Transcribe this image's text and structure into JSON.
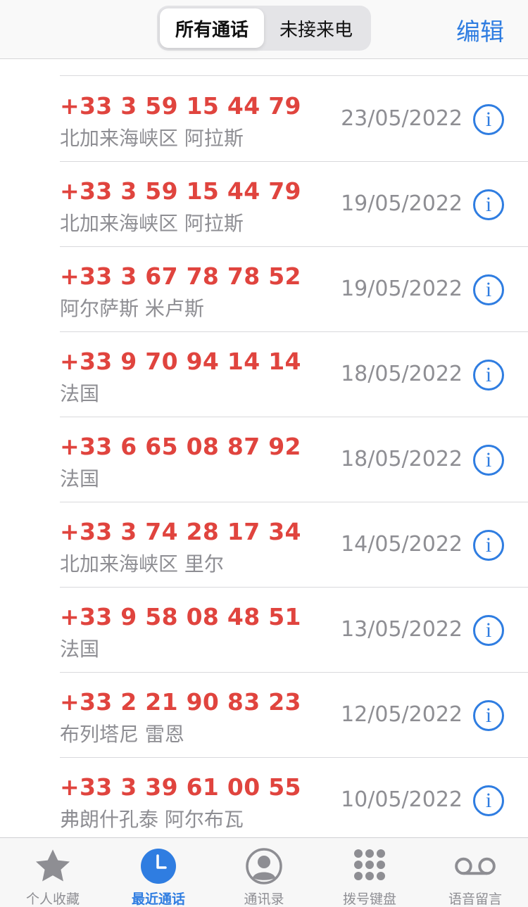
{
  "header": {
    "segments": [
      "所有通话",
      "未接来电"
    ],
    "edit_label": "编辑"
  },
  "calls": [
    {
      "number": "+33 3 59 15 44 79",
      "location": "北加来海峡区 阿拉斯",
      "date": "23/05/2022"
    },
    {
      "number": "+33 3 59 15 44 79",
      "location": "北加来海峡区 阿拉斯",
      "date": "19/05/2022"
    },
    {
      "number": "+33 3 67 78 78 52",
      "location": "阿尔萨斯 米卢斯",
      "date": "19/05/2022"
    },
    {
      "number": "+33 9 70 94 14 14",
      "location": "法国",
      "date": "18/05/2022"
    },
    {
      "number": "+33 6 65 08 87 92",
      "location": "法国",
      "date": "18/05/2022"
    },
    {
      "number": "+33 3 74 28 17 34",
      "location": "北加来海峡区 里尔",
      "date": "14/05/2022"
    },
    {
      "number": "+33 9 58 08 48 51",
      "location": "法国",
      "date": "13/05/2022"
    },
    {
      "number": "+33 2 21 90 83 23",
      "location": "布列塔尼 雷恩",
      "date": "12/05/2022"
    },
    {
      "number": "+33 3 39 61 00 55",
      "location": "弗朗什孔泰 阿尔布瓦",
      "date": "10/05/2022"
    }
  ],
  "tabbar": {
    "tabs": [
      {
        "label": "个人收藏",
        "icon": "star-icon"
      },
      {
        "label": "最近通话",
        "icon": "clock-icon"
      },
      {
        "label": "通讯录",
        "icon": "person-icon"
      },
      {
        "label": "拨号键盘",
        "icon": "keypad-icon"
      },
      {
        "label": "语音留言",
        "icon": "voicemail-icon"
      }
    ],
    "active_index": 1
  },
  "colors": {
    "accent": "#2f7de1",
    "missed": "#e0443e",
    "secondary_text": "#8e8e93"
  }
}
